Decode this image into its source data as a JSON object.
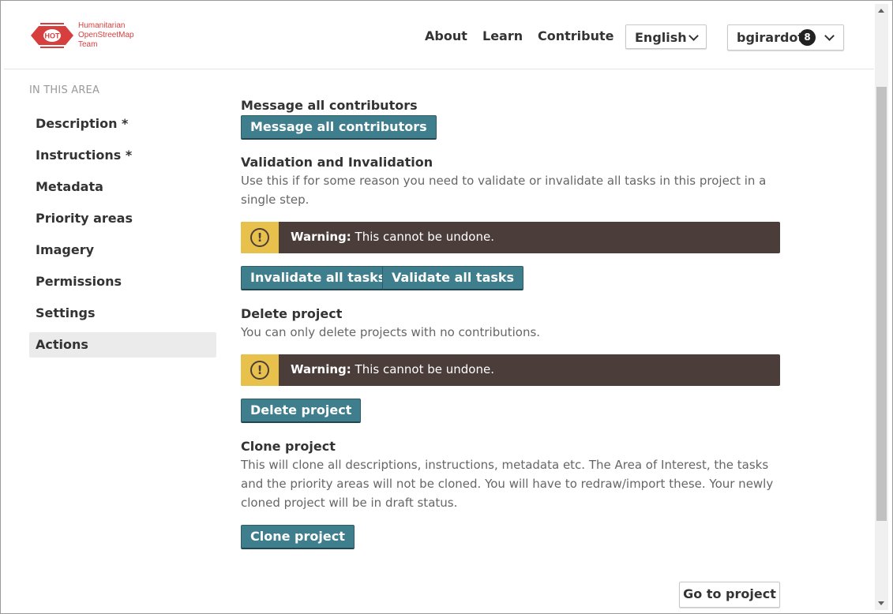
{
  "brand": {
    "logo_mark": "HOT",
    "name_line1": "Humanitarian",
    "name_line2": "OpenStreetMap",
    "name_line3": "Team",
    "color": "#d73f3f"
  },
  "nav": {
    "about": "About",
    "learn": "Learn",
    "contribute": "Contribute",
    "language": "English",
    "username": "bgirardot",
    "notification_count": "8"
  },
  "sidebar": {
    "heading": "IN THIS AREA",
    "items": [
      {
        "label": "Description *"
      },
      {
        "label": "Instructions *"
      },
      {
        "label": "Metadata"
      },
      {
        "label": "Priority areas"
      },
      {
        "label": "Imagery"
      },
      {
        "label": "Permissions"
      },
      {
        "label": "Settings"
      },
      {
        "label": "Actions",
        "active": true
      }
    ]
  },
  "message": {
    "title": "Message all contributors",
    "button": "Message all contributors"
  },
  "validation": {
    "title": "Validation and Invalidation",
    "description": "Use this if for some reason you need to validate or invalidate all tasks in this project in a single step.",
    "warning_label": "Warning:",
    "warning_text": "This cannot be undone.",
    "invalidate_button": "Invalidate all tasks",
    "validate_button": "Validate all tasks"
  },
  "delete": {
    "title": "Delete project",
    "description": "You can only delete projects with no contributions.",
    "warning_label": "Warning:",
    "warning_text": "This cannot be undone.",
    "button": "Delete project"
  },
  "clone": {
    "title": "Clone project",
    "description": "This will clone all descriptions, instructions, metadata etc. The Area of Interest, the tasks and the priority areas will not be cloned. You will have to redraw/import these. Your newly cloned project will be in draft status.",
    "button": "Clone project"
  },
  "footer": {
    "goto_button": "Go to project"
  },
  "colors": {
    "primary_button": "#3f7e8c",
    "warning_bg": "#4b3d3a",
    "warning_icon": "#e8c14d"
  }
}
